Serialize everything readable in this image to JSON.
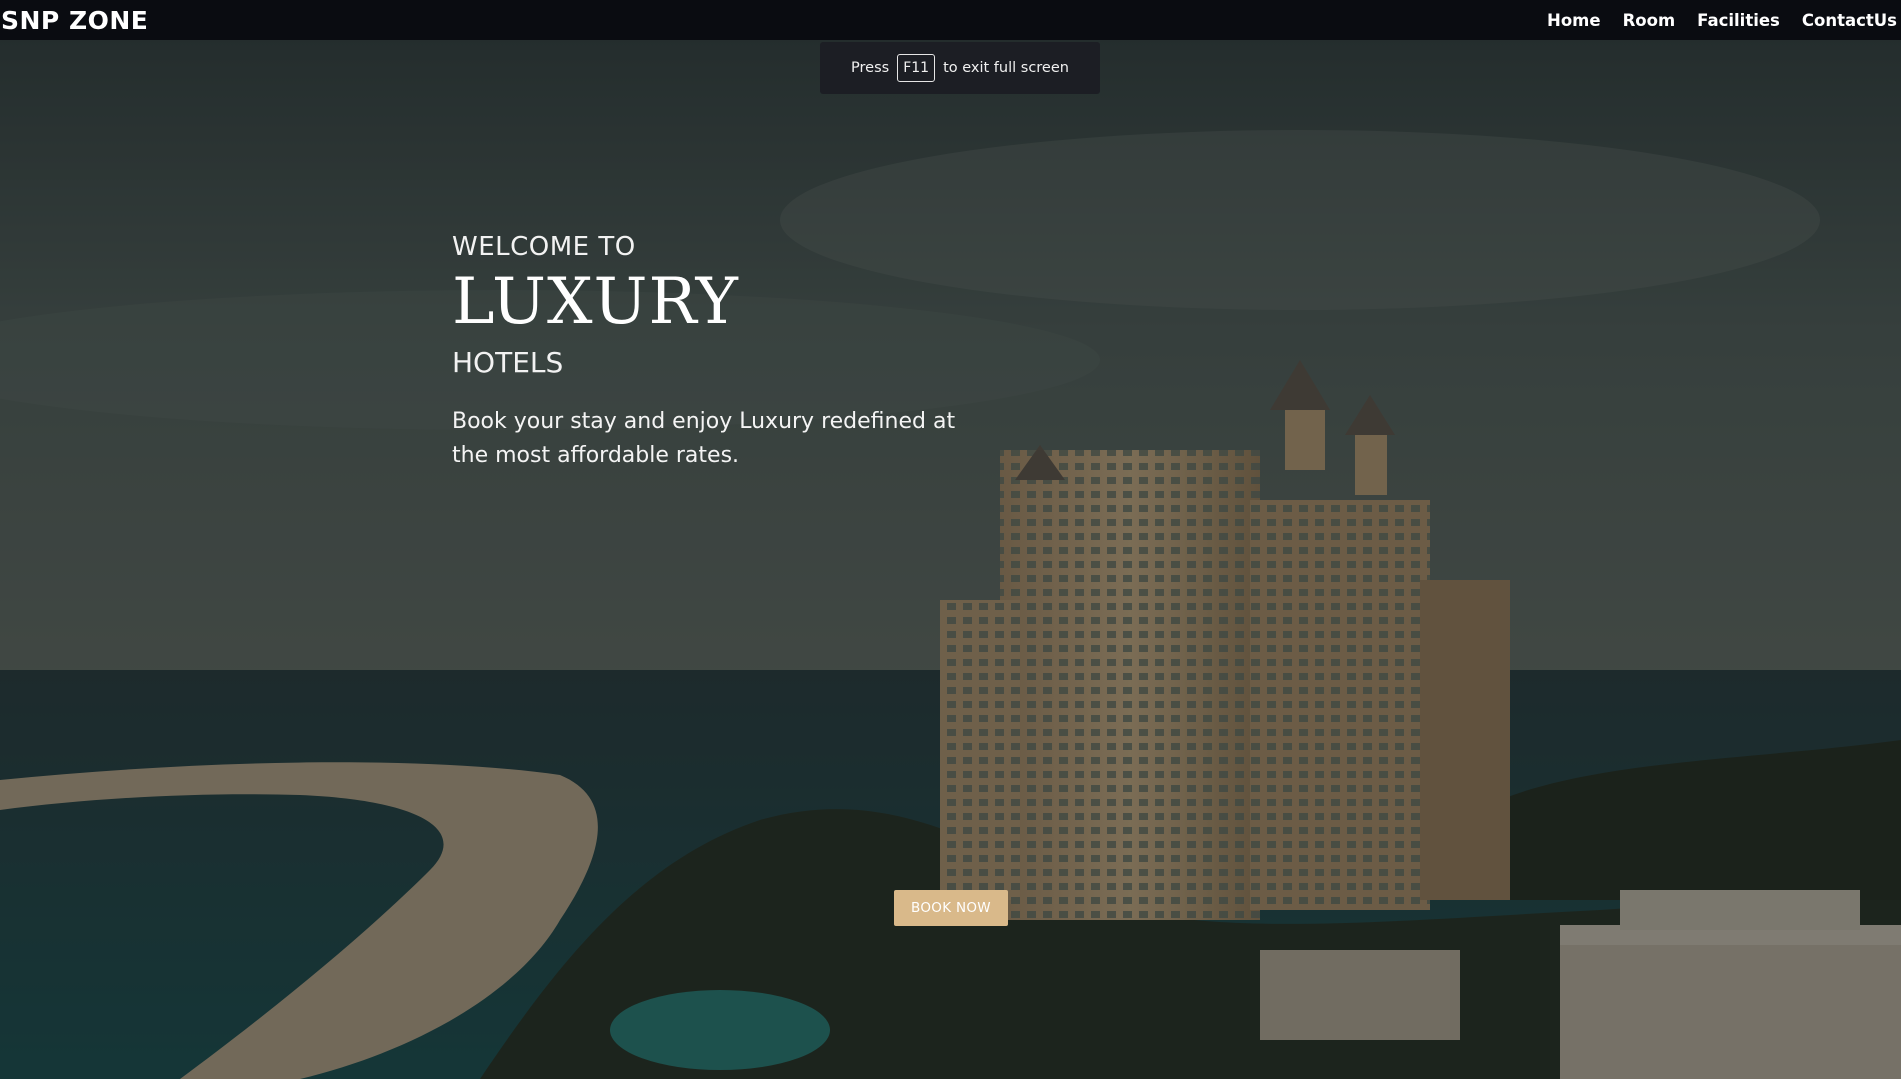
{
  "navbar": {
    "brand": "SNP ZONE",
    "links": [
      "Home",
      "Room",
      "Facilities",
      "ContactUs"
    ]
  },
  "fullscreen_notice": {
    "before": "Press",
    "key": "F11",
    "after": "to exit full screen"
  },
  "hero": {
    "welcome": "WELCOME TO",
    "headline": "LUXURY",
    "subheadline": "HOTELS",
    "tagline": "Book your stay and enjoy Luxury redefined at the most affordable rates.",
    "cta_label": "BOOK NOW",
    "background_image": "resort-hotel-beach-icon"
  },
  "colors": {
    "navbar_bg": "#0a0c11",
    "cta_bg": "#d9b98a",
    "toast_bg": "#1c1e24"
  }
}
